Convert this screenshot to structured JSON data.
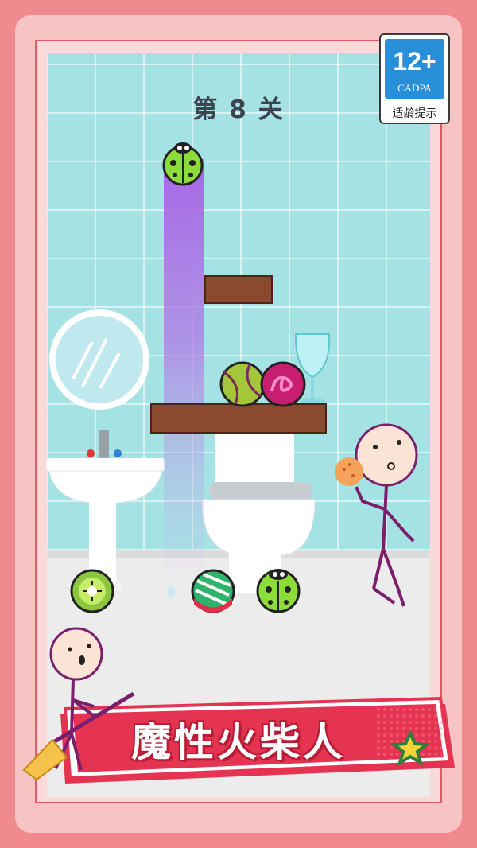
{
  "game": {
    "level_label": "第 8 关",
    "title": "魔性火柴人"
  },
  "age_rating": {
    "number": "12+",
    "org": "CADPA",
    "tip": "适龄提示"
  },
  "colors": {
    "wall": "#a4e2e4",
    "shelf": "#8b4a2f",
    "beam": "#b07ae6",
    "banner": "#e53452",
    "stickman": "#7a1f6b"
  },
  "icons": [
    "ladybug-ball-icon",
    "tennis-ball-icon",
    "pink-ball-icon",
    "kiwi-ball-icon",
    "watermelon-ball-icon",
    "star-icon"
  ]
}
